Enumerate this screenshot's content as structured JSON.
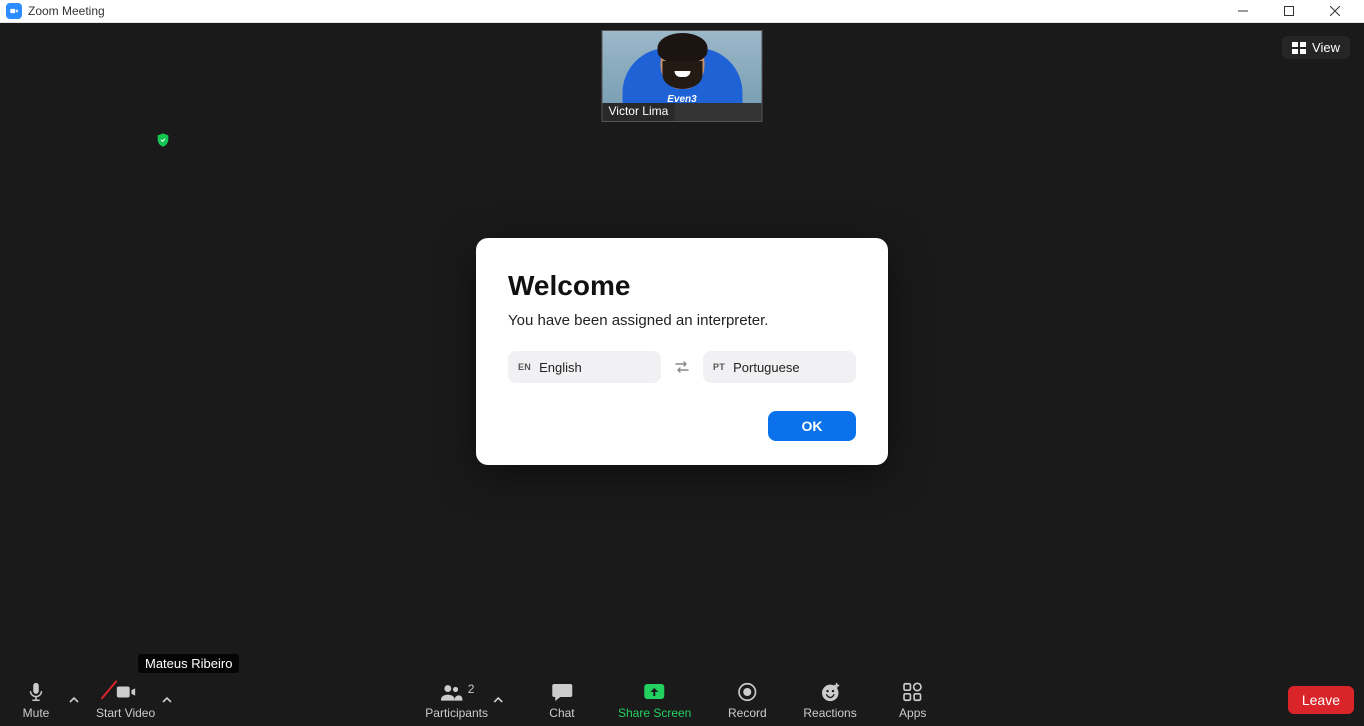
{
  "window": {
    "title": "Zoom Meeting"
  },
  "thumbnail": {
    "participant_name": "Victor Lima",
    "shirt_text": "Even3"
  },
  "view_button": {
    "label": "View"
  },
  "self_label": "Mateus Ribeiro",
  "modal": {
    "title": "Welcome",
    "message": "You have been assigned an interpreter.",
    "lang_from": {
      "code": "EN",
      "label": "English"
    },
    "lang_to": {
      "code": "PT",
      "label": "Portuguese"
    },
    "ok": "OK"
  },
  "toolbar": {
    "mute": "Mute",
    "start_video": "Start Video",
    "participants": "Participants",
    "participants_count": "2",
    "chat": "Chat",
    "share_screen": "Share Screen",
    "record": "Record",
    "reactions": "Reactions",
    "apps": "Apps",
    "leave": "Leave"
  }
}
